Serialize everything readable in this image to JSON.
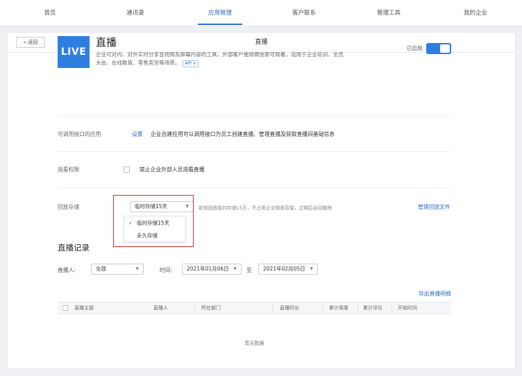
{
  "topnav": {
    "items": [
      {
        "label": "首页"
      },
      {
        "label": "通讯录"
      },
      {
        "label": "应用管理"
      },
      {
        "label": "客户联系"
      },
      {
        "label": "管理工具"
      },
      {
        "label": "我的企业"
      }
    ],
    "active_index": 2
  },
  "header": {
    "back_label": "« 返回",
    "title": "直播"
  },
  "app": {
    "logo_text": "LIVE",
    "name": "直播",
    "description_line1": "企业可对内、对外实时分享音视频及屏幕内容的工具，外部客户使用微信即可观看，适用于企业培训、全员",
    "description_line2": "大会、在线教育、零售卖货等场景。",
    "api_tag": "API ∨",
    "status_label": "已启用",
    "enabled": true
  },
  "api_row": {
    "label": "可调用接口的应用",
    "link": "设置",
    "text": "企业自建应用可以调用接口为员工创建直播、管理直播及获取直播间基础信息"
  },
  "permission_row": {
    "label": "观看权限",
    "checkbox_label": "禁止企业外部人员观看直播",
    "checked": false
  },
  "storage_row": {
    "label": "回放存储",
    "selected": "临时存储15天",
    "caret": "▼",
    "hint": "新增回放临时存储15天，不占用企业微盘容量，过期后自动删除",
    "manage_link": "管理回放文件",
    "options": [
      "临时存储15天",
      "永久存储"
    ],
    "check_mark": "✓"
  },
  "records": {
    "title": "直播记录",
    "host_label": "直播人:",
    "host_value": "全部",
    "time_label": "时间:",
    "start_date": "2021年01月06日",
    "to_label": "至",
    "end_date": "2021年02月05日",
    "export_link": "导出直播明细",
    "columns": [
      "直播主题",
      "直播人",
      "所在部门",
      "直播时长",
      "累计观看",
      "累计评论",
      "开始时间"
    ],
    "empty_text": "暂无数据"
  },
  "colors": {
    "accent": "#2a6cc3",
    "logo_bg": "#2e7ee0",
    "highlight_box": "#e02a2a"
  }
}
